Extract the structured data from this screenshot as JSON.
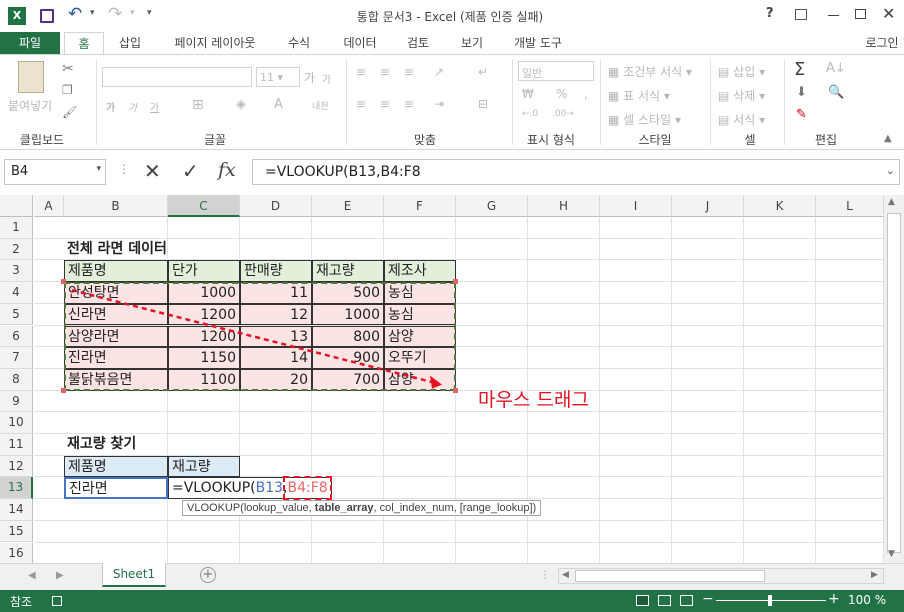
{
  "window": {
    "title": "통합 문서3 - Excel (제품 인증 실패)",
    "help": "?",
    "login": "로그인"
  },
  "ribbon_tabs": [
    "파일",
    "홈",
    "삽입",
    "페이지 레이아웃",
    "수식",
    "데이터",
    "검토",
    "보기",
    "개발 도구"
  ],
  "ribbon": {
    "clipboard": {
      "paste": "붙여넣기",
      "label": "클립보드"
    },
    "font": {
      "size": "11",
      "grow": "가",
      "shrink": "가",
      "bold": "가",
      "italic": "가",
      "underline": "가",
      "label": "글꼴",
      "phonetic": "내천"
    },
    "align": {
      "label": "맞춤"
    },
    "number": {
      "format": "일반",
      "label": "표시 형식"
    },
    "styles": {
      "cond": "조건부 서식",
      "table": "표 서식",
      "cell": "셀 스타일",
      "label": "스타일"
    },
    "cells": {
      "insert": "삽입",
      "delete": "삭제",
      "format": "서식",
      "label": "셀"
    },
    "edit": {
      "label": "편집"
    }
  },
  "formula_bar": {
    "name_box": "B4",
    "formula": "=VLOOKUP(B13,B4:F8"
  },
  "columns": [
    "A",
    "B",
    "C",
    "D",
    "E",
    "F",
    "G",
    "H",
    "I",
    "J",
    "K",
    "L"
  ],
  "rows": [
    "1",
    "2",
    "3",
    "4",
    "5",
    "6",
    "7",
    "8",
    "9",
    "10",
    "11",
    "12",
    "13",
    "14",
    "15",
    "16"
  ],
  "sheet": {
    "title1": "전체 라면 데이터",
    "headers": [
      "제품명",
      "단가",
      "판매량",
      "재고량",
      "제조사"
    ],
    "data": [
      [
        "안성탕면",
        "1000",
        "11",
        "500",
        "농심"
      ],
      [
        "신라면",
        "1200",
        "12",
        "1000",
        "농심"
      ],
      [
        "삼양라면",
        "1200",
        "13",
        "800",
        "삼양"
      ],
      [
        "진라면",
        "1150",
        "14",
        "900",
        "오뚜기"
      ],
      [
        "불닭볶음면",
        "1100",
        "20",
        "700",
        "삼양"
      ]
    ],
    "title2": "재고량 찾기",
    "lookup_headers": [
      "제품명",
      "재고량"
    ],
    "lookup_name": "진라면",
    "edit_prefix": "=VLOOKUP(",
    "edit_ref1": "B13",
    "edit_comma": ",",
    "edit_ref2": "B4:F8",
    "annotation": "마우스 드래그",
    "tooltip": {
      "prefix": "VLOOKUP(lookup_value, ",
      "bold": "table_array",
      "suffix": ", col_index_num, [range_lookup])"
    }
  },
  "sheet_tab": "Sheet1",
  "status": {
    "mode": "참조",
    "zoom": "100 %"
  },
  "colors": {
    "excel_green": "#217346",
    "header_fill": "#e2efda",
    "data_fill": "#fce4e4",
    "lookup_fill": "#ddebf7",
    "annotation_red": "#e81123"
  }
}
